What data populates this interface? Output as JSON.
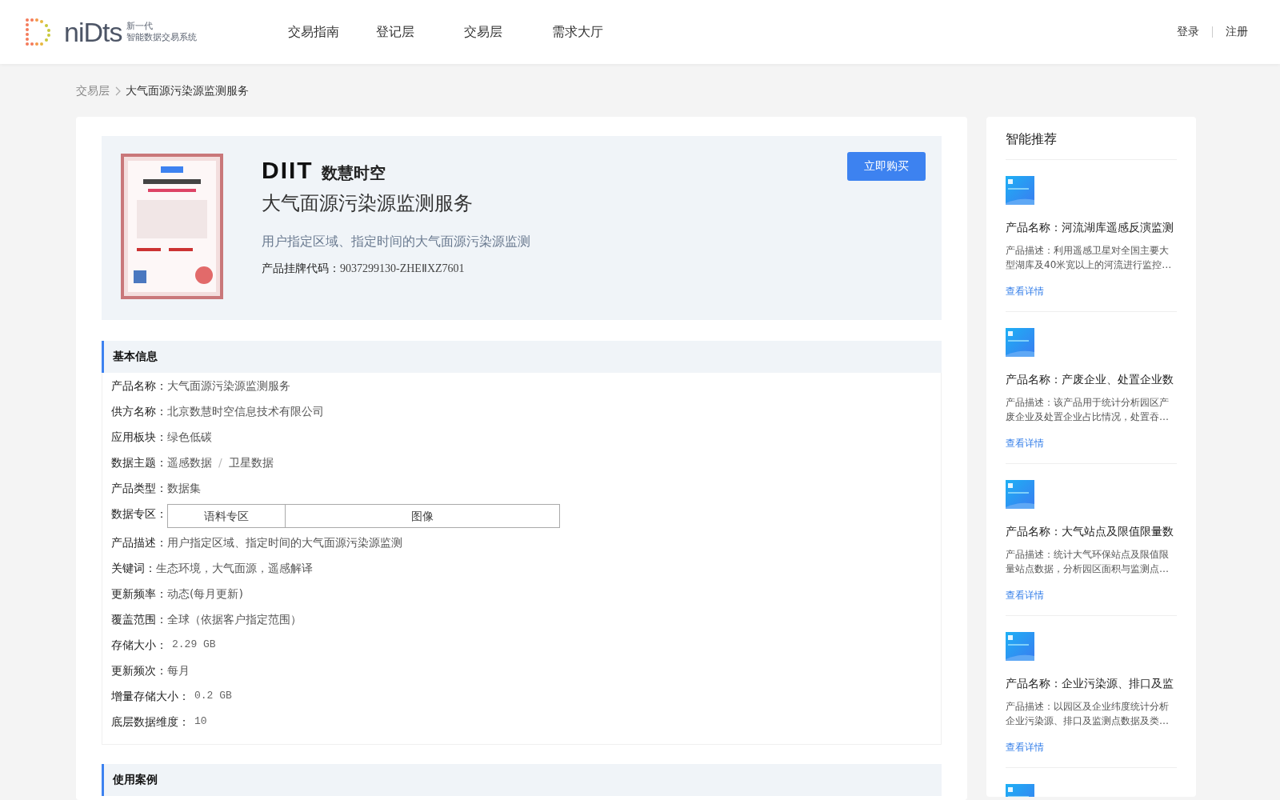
{
  "header": {
    "logo": {
      "name": "niDts",
      "tagline_1": "新一代",
      "tagline_2": "智能数据交易系统"
    },
    "nav": [
      {
        "label": "交易指南"
      },
      {
        "label": "登记层"
      },
      {
        "label": "交易层"
      },
      {
        "label": "需求大厅"
      }
    ],
    "auth": [
      "登录",
      "注册"
    ]
  },
  "breadcrumb": [
    "交易层",
    "大气面源污染源监测服务"
  ],
  "product": {
    "brand": {
      "mark": "DIIT",
      "name": "数慧时空"
    },
    "title": "大气面源污染源监测服务",
    "subtitle": "用户指定区域、指定时间的大气面源污染源监测",
    "code_label": "产品挂牌代码：",
    "code": "9037299130-ZHEⅡXZ7601",
    "buy_button": "立即购买"
  },
  "basic_info": {
    "title": "基本信息",
    "fields": [
      {
        "kind": "text",
        "label": "产品名称：",
        "value": "大气面源污染源监测服务"
      },
      {
        "kind": "text",
        "label": "供方名称：",
        "value": "北京数慧时空信息技术有限公司"
      },
      {
        "kind": "text",
        "label": "应用板块：",
        "value": "绿色低碳"
      },
      {
        "kind": "path",
        "label": "数据主题：",
        "separator": "/",
        "values": [
          "遥感数据",
          "卫星数据"
        ]
      },
      {
        "kind": "text",
        "label": "产品类型：",
        "value": "数据集"
      },
      {
        "kind": "tags",
        "label": "数据专区：",
        "values": [
          "语料专区",
          "图像"
        ]
      },
      {
        "kind": "text",
        "label": "产品描述：",
        "value": "用户指定区域、指定时间的大气面源污染源监测"
      },
      {
        "kind": "text",
        "label": "关键词：",
        "value": "生态环境，大气面源，遥感解译"
      },
      {
        "kind": "text",
        "label": "更新频率：",
        "value": "动态(每月更新)"
      },
      {
        "kind": "text",
        "label": "覆盖范围：",
        "value": "全球（依据客户指定范围）"
      },
      {
        "kind": "numeric",
        "label": "存储大小：",
        "value": "2.29 GB"
      },
      {
        "kind": "text",
        "label": "更新频次：",
        "value": "每月"
      },
      {
        "kind": "numeric",
        "label": "增量存储大小：",
        "value": "0.2 GB"
      },
      {
        "kind": "numeric",
        "label": "底层数据维度：",
        "value": "10"
      }
    ]
  },
  "use_cases": {
    "title": "使用案例"
  },
  "recommend": {
    "title": "智能推荐",
    "items": [
      {
        "kind": "card",
        "name": "产品名称：河流湖库遥感反演监测",
        "description": "产品描述：利用遥感卫星对全国主要大型湖库及40米宽以上的河流进行监控…",
        "link": "查看详情"
      },
      {
        "kind": "card",
        "name": "产品名称：产废企业、处置企业数",
        "description": "产品描述：该产品用于统计分析园区产废企业及处置企业占比情况，处置吞…",
        "link": "查看详情"
      },
      {
        "kind": "card",
        "name": "产品名称：大气站点及限值限量数",
        "description": "产品描述：统计大气环保站点及限值限量站点数据，分析园区面积与监测点…",
        "link": "查看详情"
      },
      {
        "kind": "card",
        "name": "产品名称：企业污染源、排口及监",
        "description": "产品描述：以园区及企业纬度统计分析企业污染源、排口及监测点数据及类…",
        "link": "查看详情"
      },
      {
        "kind": "thumbnail"
      }
    ]
  }
}
